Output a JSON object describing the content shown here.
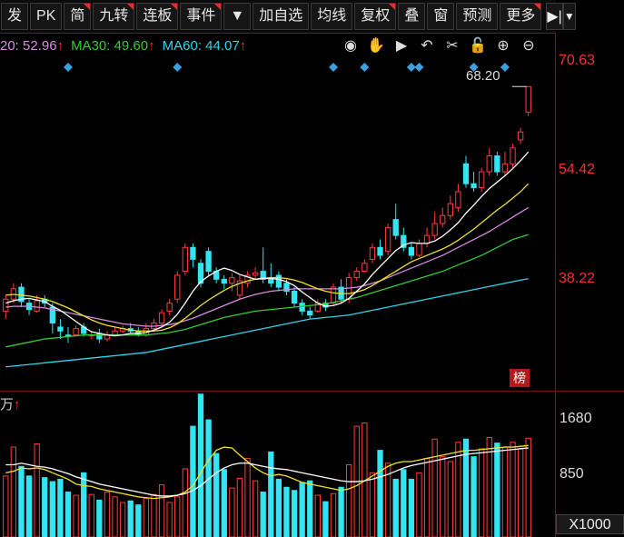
{
  "toolbar": {
    "buttons": [
      {
        "label": "发",
        "flag": false
      },
      {
        "label": "PK",
        "flag": false
      },
      {
        "label": "简",
        "flag": true
      },
      {
        "label": "九转",
        "flag": true
      },
      {
        "label": "连板",
        "flag": true
      },
      {
        "label": "事件",
        "flag": true
      },
      {
        "label": "▼",
        "flag": false
      },
      {
        "label": "加自选",
        "flag": false
      },
      {
        "label": "均线",
        "flag": false
      },
      {
        "label": "复权",
        "flag": true
      },
      {
        "label": "叠",
        "flag": false
      },
      {
        "label": "窗",
        "flag": false
      },
      {
        "label": "预测",
        "flag": false
      },
      {
        "label": "更多",
        "flag": true
      }
    ],
    "right_icon": "▶|",
    "dropdown": "▼"
  },
  "ma_legend": [
    {
      "text": "20: 52.96",
      "color": "#d98be0",
      "arrow": "↑"
    },
    {
      "text": "MA30: 49.60",
      "color": "#38c838",
      "arrow": "↑"
    },
    {
      "text": "MA60: 44.07",
      "color": "#30d4e8",
      "arrow": "↑"
    }
  ],
  "tools": [
    "eye-icon",
    "hand-icon",
    "play-icon",
    "undo-icon",
    "scissors-icon",
    "lock-icon",
    "zoom-in-icon",
    "zoom-out-icon"
  ],
  "price_axis": {
    "top": "70.63",
    "mid": "54.42",
    "low": "38.22"
  },
  "high_label": "68.20",
  "badge": "榜",
  "volume": {
    "title": "万",
    "arrow": "↑",
    "axis_high": "1680",
    "axis_mid": "850",
    "unit": "X1000"
  },
  "colors": {
    "up": "#ff3b3b",
    "down": "#33e4f2",
    "ma5": "#ffffff",
    "ma10": "#f2e128",
    "ma20": "#d98be0",
    "ma30": "#38c838",
    "ma60": "#30d4e8"
  },
  "chart_data": {
    "type": "candlestick",
    "y_range": [
      30,
      72
    ],
    "candles": [
      {
        "o": 40.0,
        "c": 41.5,
        "h": 42.0,
        "l": 39.0
      },
      {
        "o": 41.5,
        "c": 42.8,
        "h": 43.5,
        "l": 41.0
      },
      {
        "o": 43.0,
        "c": 41.2,
        "h": 43.5,
        "l": 40.5
      },
      {
        "o": 41.0,
        "c": 40.2,
        "h": 41.5,
        "l": 39.5
      },
      {
        "o": 40.0,
        "c": 41.3,
        "h": 42.0,
        "l": 39.8
      },
      {
        "o": 41.5,
        "c": 41.0,
        "h": 42.0,
        "l": 40.5
      },
      {
        "o": 40.5,
        "c": 38.5,
        "h": 41.0,
        "l": 37.2
      },
      {
        "o": 38.0,
        "c": 37.5,
        "h": 39.0,
        "l": 36.5
      },
      {
        "o": 37.0,
        "c": 36.8,
        "h": 38.0,
        "l": 36.0
      },
      {
        "o": 37.0,
        "c": 37.8,
        "h": 38.2,
        "l": 36.8
      },
      {
        "o": 38.0,
        "c": 37.2,
        "h": 38.5,
        "l": 36.8
      },
      {
        "o": 37.0,
        "c": 37.0,
        "h": 37.5,
        "l": 36.5
      },
      {
        "o": 37.2,
        "c": 36.5,
        "h": 37.8,
        "l": 36.0
      },
      {
        "o": 36.5,
        "c": 37.0,
        "h": 37.5,
        "l": 36.2
      },
      {
        "o": 37.0,
        "c": 37.5,
        "h": 38.0,
        "l": 36.8
      },
      {
        "o": 37.5,
        "c": 37.8,
        "h": 38.2,
        "l": 37.2
      },
      {
        "o": 37.8,
        "c": 37.5,
        "h": 38.5,
        "l": 37.2
      },
      {
        "o": 37.5,
        "c": 37.0,
        "h": 38.0,
        "l": 36.8
      },
      {
        "o": 37.0,
        "c": 37.8,
        "h": 38.5,
        "l": 36.8
      },
      {
        "o": 37.8,
        "c": 38.5,
        "h": 39.0,
        "l": 37.5
      },
      {
        "o": 38.5,
        "c": 39.8,
        "h": 40.2,
        "l": 38.2
      },
      {
        "o": 40.0,
        "c": 41.0,
        "h": 41.5,
        "l": 39.5
      },
      {
        "o": 41.5,
        "c": 44.5,
        "h": 45.0,
        "l": 41.0
      },
      {
        "o": 45.0,
        "c": 48.0,
        "h": 48.5,
        "l": 44.5
      },
      {
        "o": 48.0,
        "c": 46.5,
        "h": 48.5,
        "l": 45.5
      },
      {
        "o": 46.0,
        "c": 43.5,
        "h": 46.5,
        "l": 43.0
      },
      {
        "o": 47.5,
        "c": 45.0,
        "h": 48.0,
        "l": 44.5
      },
      {
        "o": 45.0,
        "c": 44.0,
        "h": 45.5,
        "l": 43.5
      },
      {
        "o": 44.0,
        "c": 43.5,
        "h": 44.5,
        "l": 42.8
      },
      {
        "o": 43.5,
        "c": 44.2,
        "h": 44.8,
        "l": 42.5
      },
      {
        "o": 42.0,
        "c": 43.8,
        "h": 44.5,
        "l": 41.5
      },
      {
        "o": 43.5,
        "c": 44.5,
        "h": 45.0,
        "l": 43.0
      },
      {
        "o": 44.5,
        "c": 44.8,
        "h": 45.5,
        "l": 44.0
      },
      {
        "o": 45.0,
        "c": 44.0,
        "h": 48.0,
        "l": 43.5
      },
      {
        "o": 44.0,
        "c": 43.5,
        "h": 46.0,
        "l": 43.0
      },
      {
        "o": 44.5,
        "c": 43.0,
        "h": 45.0,
        "l": 42.5
      },
      {
        "o": 43.5,
        "c": 42.5,
        "h": 44.0,
        "l": 42.0
      },
      {
        "o": 42.5,
        "c": 41.0,
        "h": 43.0,
        "l": 40.5
      },
      {
        "o": 41.0,
        "c": 40.0,
        "h": 41.5,
        "l": 39.5
      },
      {
        "o": 40.0,
        "c": 39.5,
        "h": 40.5,
        "l": 39.0
      },
      {
        "o": 40.0,
        "c": 41.0,
        "h": 41.5,
        "l": 39.8
      },
      {
        "o": 41.0,
        "c": 40.5,
        "h": 41.5,
        "l": 40.0
      },
      {
        "o": 41.0,
        "c": 43.0,
        "h": 43.5,
        "l": 40.8
      },
      {
        "o": 43.0,
        "c": 41.5,
        "h": 44.0,
        "l": 41.0
      },
      {
        "o": 41.5,
        "c": 44.2,
        "h": 44.8,
        "l": 41.0
      },
      {
        "o": 44.2,
        "c": 45.0,
        "h": 45.5,
        "l": 43.8
      },
      {
        "o": 45.0,
        "c": 46.0,
        "h": 46.5,
        "l": 44.8
      },
      {
        "o": 46.5,
        "c": 48.0,
        "h": 48.5,
        "l": 46.0
      },
      {
        "o": 48.0,
        "c": 47.0,
        "h": 49.0,
        "l": 46.5
      },
      {
        "o": 47.5,
        "c": 50.5,
        "h": 51.0,
        "l": 47.0
      },
      {
        "o": 51.5,
        "c": 49.5,
        "h": 53.5,
        "l": 49.0
      },
      {
        "o": 49.5,
        "c": 48.0,
        "h": 50.5,
        "l": 47.5
      },
      {
        "o": 48.0,
        "c": 47.0,
        "h": 48.5,
        "l": 46.5
      },
      {
        "o": 47.0,
        "c": 48.5,
        "h": 49.0,
        "l": 46.8
      },
      {
        "o": 48.5,
        "c": 49.5,
        "h": 50.5,
        "l": 48.0
      },
      {
        "o": 49.5,
        "c": 51.0,
        "h": 52.5,
        "l": 49.0
      },
      {
        "o": 51.0,
        "c": 52.0,
        "h": 53.0,
        "l": 50.5
      },
      {
        "o": 52.0,
        "c": 53.5,
        "h": 54.5,
        "l": 51.5
      },
      {
        "o": 53.0,
        "c": 55.0,
        "h": 56.0,
        "l": 52.5
      },
      {
        "o": 58.5,
        "c": 56.0,
        "h": 59.5,
        "l": 55.5
      },
      {
        "o": 56.0,
        "c": 55.5,
        "h": 57.5,
        "l": 55.0
      },
      {
        "o": 55.5,
        "c": 57.5,
        "h": 58.0,
        "l": 55.0
      },
      {
        "o": 57.5,
        "c": 59.5,
        "h": 60.5,
        "l": 57.0
      },
      {
        "o": 59.5,
        "c": 57.5,
        "h": 60.0,
        "l": 57.0
      },
      {
        "o": 57.5,
        "c": 58.5,
        "h": 60.0,
        "l": 57.0
      },
      {
        "o": 58.5,
        "c": 60.5,
        "h": 61.0,
        "l": 58.0
      },
      {
        "o": 61.5,
        "c": 62.5,
        "h": 63.0,
        "l": 61.0
      },
      {
        "o": 65.0,
        "c": 68.2,
        "h": 68.2,
        "l": 64.5
      }
    ],
    "ma5": [
      41.0,
      41.3,
      41.5,
      41.6,
      41.4,
      41.2,
      40.6,
      40.1,
      39.4,
      38.7,
      38.0,
      37.4,
      37.2,
      37.0,
      36.9,
      37.0,
      37.2,
      37.2,
      37.3,
      37.6,
      38.0,
      38.6,
      39.6,
      41.0,
      42.5,
      43.7,
      44.4,
      45.0,
      45.4,
      45.1,
      44.6,
      44.3,
      44.0,
      44.1,
      44.1,
      44.0,
      43.7,
      43.2,
      42.4,
      41.7,
      41.0,
      40.6,
      40.7,
      41.0,
      41.6,
      42.5,
      43.4,
      44.6,
      45.6,
      46.6,
      47.6,
      48.3,
      48.6,
      48.5,
      48.5,
      48.8,
      49.4,
      50.2,
      51.1,
      52.3,
      53.3,
      54.4,
      55.4,
      56.2,
      57.0,
      57.9,
      58.9,
      60.0
    ],
    "ma10": [
      42.0,
      42.1,
      42.0,
      41.9,
      41.7,
      41.5,
      41.2,
      40.8,
      40.4,
      39.9,
      39.4,
      38.9,
      38.5,
      38.2,
      38.0,
      37.8,
      37.6,
      37.5,
      37.5,
      37.5,
      37.6,
      37.9,
      38.4,
      39.1,
      39.9,
      40.7,
      41.4,
      42.0,
      42.6,
      43.1,
      43.5,
      43.8,
      44.0,
      44.1,
      44.2,
      44.2,
      44.1,
      43.9,
      43.6,
      43.2,
      42.8,
      42.5,
      42.3,
      42.2,
      42.2,
      42.4,
      42.7,
      43.2,
      43.8,
      44.4,
      45.0,
      45.6,
      46.2,
      46.6,
      47.0,
      47.4,
      47.8,
      48.3,
      48.9,
      49.6,
      50.3,
      51.1,
      51.9,
      52.7,
      53.4,
      54.2,
      55.0,
      56.0
    ],
    "ma20": [
      40.5,
      40.6,
      40.6,
      40.6,
      40.5,
      40.4,
      40.2,
      40.0,
      39.8,
      39.6,
      39.4,
      39.2,
      39.0,
      38.8,
      38.6,
      38.4,
      38.3,
      38.2,
      38.1,
      38.1,
      38.2,
      38.3,
      38.5,
      38.8,
      39.1,
      39.5,
      39.9,
      40.3,
      40.7,
      41.1,
      41.5,
      41.8,
      42.1,
      42.3,
      42.5,
      42.6,
      42.7,
      42.8,
      42.8,
      42.8,
      42.8,
      42.8,
      42.8,
      42.8,
      42.9,
      43.0,
      43.2,
      43.5,
      43.8,
      44.2,
      44.6,
      45.0,
      45.4,
      45.8,
      46.2,
      46.6,
      47.0,
      47.5,
      48.0,
      48.5,
      49.0,
      49.5,
      50.0,
      50.6,
      51.2,
      51.8,
      52.4,
      53.0
    ],
    "ma30": [
      35.5,
      35.7,
      35.9,
      36.1,
      36.3,
      36.5,
      36.6,
      36.7,
      36.8,
      36.9,
      37.0,
      37.0,
      37.0,
      37.0,
      37.0,
      37.0,
      37.0,
      37.0,
      37.0,
      37.1,
      37.2,
      37.3,
      37.5,
      37.7,
      38.0,
      38.3,
      38.6,
      38.9,
      39.2,
      39.4,
      39.6,
      39.8,
      40.0,
      40.1,
      40.2,
      40.3,
      40.4,
      40.5,
      40.6,
      40.7,
      40.8,
      40.9,
      41.1,
      41.3,
      41.5,
      41.7,
      42.0,
      42.3,
      42.6,
      42.9,
      43.2,
      43.5,
      43.8,
      44.1,
      44.4,
      44.7,
      45.0,
      45.4,
      45.8,
      46.2,
      46.6,
      47.0,
      47.5,
      48.0,
      48.5,
      49.0,
      49.3,
      49.6
    ],
    "ma60": [
      33.0,
      33.1,
      33.2,
      33.3,
      33.4,
      33.5,
      33.6,
      33.7,
      33.8,
      33.9,
      34.0,
      34.1,
      34.2,
      34.3,
      34.4,
      34.5,
      34.6,
      34.7,
      34.8,
      35.0,
      35.2,
      35.4,
      35.6,
      35.8,
      36.0,
      36.2,
      36.4,
      36.6,
      36.8,
      37.0,
      37.2,
      37.4,
      37.6,
      37.8,
      38.0,
      38.2,
      38.4,
      38.6,
      38.8,
      39.0,
      39.1,
      39.2,
      39.3,
      39.4,
      39.5,
      39.7,
      39.9,
      40.1,
      40.3,
      40.5,
      40.7,
      40.9,
      41.1,
      41.3,
      41.5,
      41.7,
      41.9,
      42.1,
      42.3,
      42.5,
      42.7,
      42.9,
      43.1,
      43.3,
      43.5,
      43.7,
      43.9,
      44.07
    ],
    "volume_range": [
      0,
      1800
    ],
    "volumes": [
      760,
      1120,
      880,
      760,
      1160,
      740,
      690,
      720,
      560,
      520,
      800,
      530,
      460,
      560,
      500,
      430,
      450,
      400,
      480,
      530,
      650,
      430,
      500,
      850,
      1380,
      1780,
      1460,
      1040,
      840,
      610,
      730,
      980,
      700,
      560,
      1060,
      720,
      620,
      580,
      680,
      700,
      520,
      440,
      540,
      620,
      900,
      1380,
      1420,
      800,
      1080,
      920,
      720,
      840,
      720,
      800,
      980,
      1220,
      1000,
      940,
      1180,
      1220,
      1000,
      1100,
      1240,
      1170,
      1120,
      1180,
      1100,
      1230
    ],
    "vol_ma1": [
      800,
      820,
      860,
      850,
      860,
      840,
      800,
      760,
      720,
      660,
      640,
      630,
      600,
      580,
      560,
      540,
      520,
      500,
      490,
      480,
      490,
      500,
      520,
      560,
      640,
      800,
      960,
      1080,
      1120,
      1110,
      1020,
      940,
      860,
      800,
      760,
      780,
      760,
      720,
      680,
      660,
      640,
      620,
      600,
      580,
      600,
      640,
      700,
      760,
      820,
      880,
      920,
      940,
      940,
      960,
      980,
      1000,
      1020,
      1040,
      1060,
      1080,
      1080,
      1090,
      1100,
      1110,
      1120,
      1120,
      1130,
      1140
    ],
    "vol_ma2": [
      900,
      900,
      920,
      900,
      880,
      870,
      850,
      820,
      790,
      750,
      720,
      690,
      660,
      640,
      620,
      600,
      580,
      560,
      540,
      520,
      510,
      510,
      520,
      540,
      580,
      640,
      720,
      800,
      860,
      900,
      920,
      920,
      900,
      880,
      860,
      850,
      840,
      820,
      800,
      780,
      760,
      740,
      720,
      700,
      690,
      690,
      700,
      720,
      750,
      780,
      820,
      860,
      890,
      910,
      930,
      950,
      970,
      990,
      1010,
      1030,
      1040,
      1050,
      1060,
      1070,
      1080,
      1090,
      1100,
      1110
    ]
  }
}
